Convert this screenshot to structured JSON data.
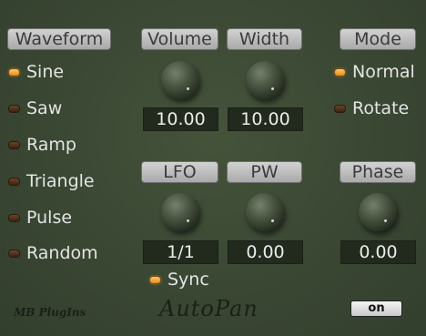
{
  "waveform": {
    "title": "Waveform",
    "options": [
      {
        "label": "Sine",
        "active": true
      },
      {
        "label": "Saw",
        "active": false
      },
      {
        "label": "Ramp",
        "active": false
      },
      {
        "label": "Triangle",
        "active": false
      },
      {
        "label": "Pulse",
        "active": false
      },
      {
        "label": "Random",
        "active": false
      }
    ]
  },
  "volume": {
    "title": "Volume",
    "value": "10.00"
  },
  "width": {
    "title": "Width",
    "value": "10.00"
  },
  "mode": {
    "title": "Mode",
    "options": [
      {
        "label": "Normal",
        "active": true
      },
      {
        "label": "Rotate",
        "active": false
      }
    ]
  },
  "lfo": {
    "title": "LFO",
    "value": "1/1"
  },
  "pw": {
    "title": "PW",
    "value": "0.00"
  },
  "phase": {
    "title": "Phase",
    "value": "0.00"
  },
  "sync": {
    "label": "Sync",
    "active": true
  },
  "footer": {
    "brand": "MB PlugIns",
    "product": "AutoPan",
    "power_label": "on"
  },
  "colors": {
    "background": "#3b4834",
    "led_on": "#f0a53a",
    "led_off": "#5a3a22",
    "display_bg": "#222a1d",
    "header_bg": "#c0c0c0"
  }
}
